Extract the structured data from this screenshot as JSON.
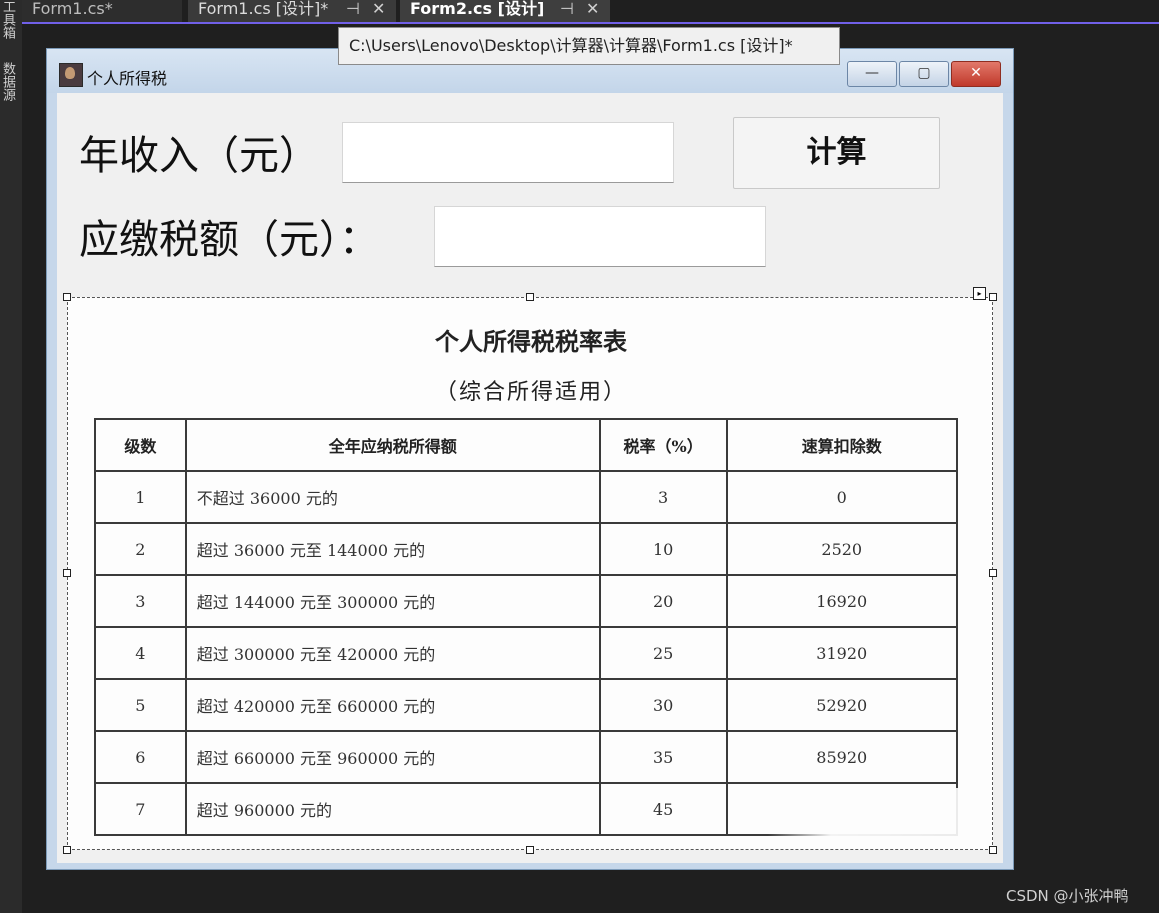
{
  "ide": {
    "left_strip_labels": [
      "工具箱",
      "数据源"
    ],
    "tabs": [
      {
        "label": "Form1.cs*"
      },
      {
        "label": "Form1.cs [设计]*"
      },
      {
        "label": "Form2.cs [设计]"
      }
    ],
    "pin_glyph": "⊣",
    "close_glyph": "✕",
    "tooltip": "C:\\Users\\Lenovo\\Desktop\\计算器\\计算器\\Form1.cs [设计]*",
    "watermark": "CSDN @小张冲鸭"
  },
  "form": {
    "title": "个人所得税",
    "caption_buttons": {
      "minimize": "—",
      "maximize": "▢",
      "close": "✕"
    },
    "income_label": "年收入（元）",
    "income_value": "",
    "tax_label": "应缴税额（元）：",
    "tax_value": "",
    "calc_button": "计算"
  },
  "tax_table": {
    "title": "个人所得税税率表",
    "subtitle": "（综合所得适用）",
    "headers": [
      "级数",
      "全年应纳税所得额",
      "税率（%）",
      "速算扣除数"
    ],
    "rows": [
      [
        "1",
        "不超过 36000 元的",
        "3",
        "0"
      ],
      [
        "2",
        "超过 36000 元至 144000 元的",
        "10",
        "2520"
      ],
      [
        "3",
        "超过 144000 元至 300000 元的",
        "20",
        "16920"
      ],
      [
        "4",
        "超过 300000 元至 420000 元的",
        "25",
        "31920"
      ],
      [
        "5",
        "超过 420000 元至 660000 元的",
        "30",
        "52920"
      ],
      [
        "6",
        "超过 660000 元至 960000 元的",
        "35",
        "85920"
      ],
      [
        "7",
        "超过 960000 元的",
        "45",
        ""
      ]
    ]
  },
  "designer": {
    "smart_tag_glyph": "▸"
  }
}
